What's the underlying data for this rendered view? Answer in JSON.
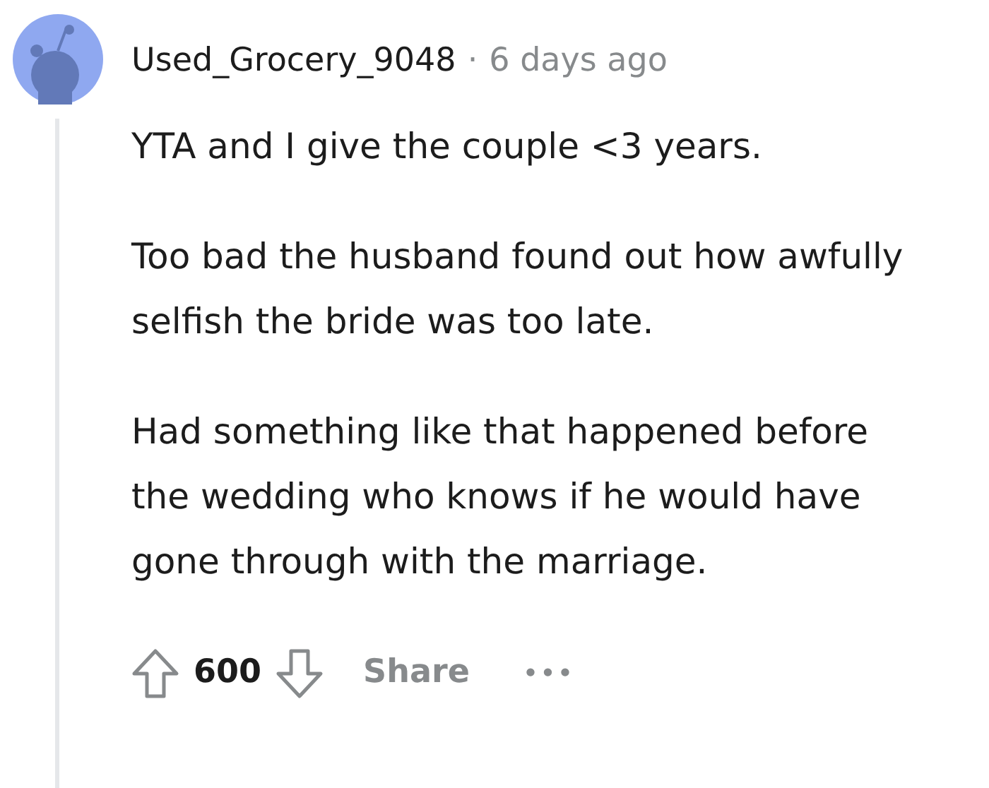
{
  "comment": {
    "author": "Used_Grocery_9048",
    "separator": "·",
    "time": "6 days ago",
    "paragraphs": [
      "YTA and I give the couple <3 years.",
      "Too bad the husband found out how awfully selfish the bride was too late.",
      "Had something like that happened before the wedding who knows if he would have gone through with the marriage."
    ],
    "score": "600",
    "share": "Share",
    "more": "•••"
  }
}
